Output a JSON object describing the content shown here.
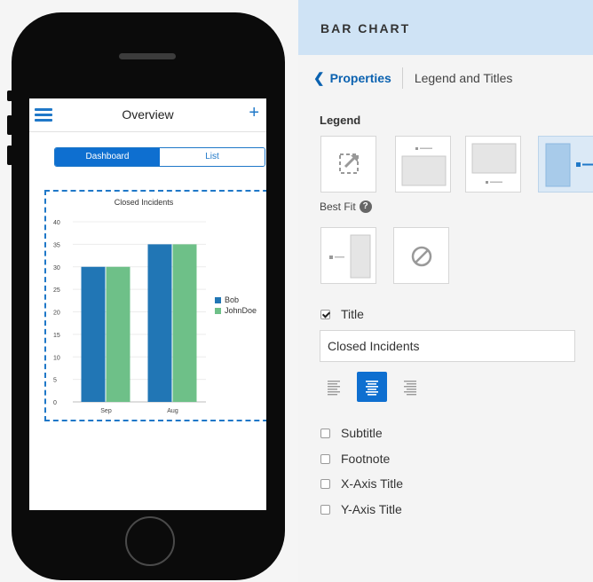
{
  "phone": {
    "app_title": "Overview",
    "add_icon_glyph": "+",
    "tabs": [
      {
        "label": "Dashboard",
        "active": true
      },
      {
        "label": "List",
        "active": false
      }
    ]
  },
  "chart_data": {
    "type": "bar",
    "title": "Closed Incidents",
    "categories": [
      "Sep",
      "Aug"
    ],
    "series": [
      {
        "name": "Bob",
        "values": [
          30,
          35
        ],
        "color": "#2176b5"
      },
      {
        "name": "JohnDoe",
        "values": [
          30,
          35
        ],
        "color": "#6ec088"
      }
    ],
    "ylim": [
      0,
      40
    ],
    "yticks": [
      "0",
      "5",
      "10",
      "15",
      "20",
      "25",
      "30",
      "35",
      "40"
    ],
    "xlabel": "",
    "ylabel": "",
    "grid": true,
    "legend": "right"
  },
  "panel": {
    "header": "BAR CHART",
    "back_label": "Properties",
    "current_label": "Legend and Titles",
    "legend_label": "Legend",
    "best_fit_label": "Best Fit",
    "help_glyph": "?",
    "legend_options": [
      "best-fit",
      "top",
      "bottom",
      "right",
      "left",
      "none"
    ],
    "selected_legend_option": "right",
    "title_checkbox": {
      "label": "Title",
      "checked": true
    },
    "title_value": "Closed Incidents",
    "alignment_selected": "center",
    "options": [
      {
        "label": "Subtitle",
        "checked": false
      },
      {
        "label": "Footnote",
        "checked": false
      },
      {
        "label": "X-Axis Title",
        "checked": false
      },
      {
        "label": "Y-Axis Title",
        "checked": false
      }
    ]
  },
  "colors": {
    "accent": "#0e6fd0",
    "header_bg": "#cfe3f5",
    "selected_tile": "#dbe9f6"
  }
}
